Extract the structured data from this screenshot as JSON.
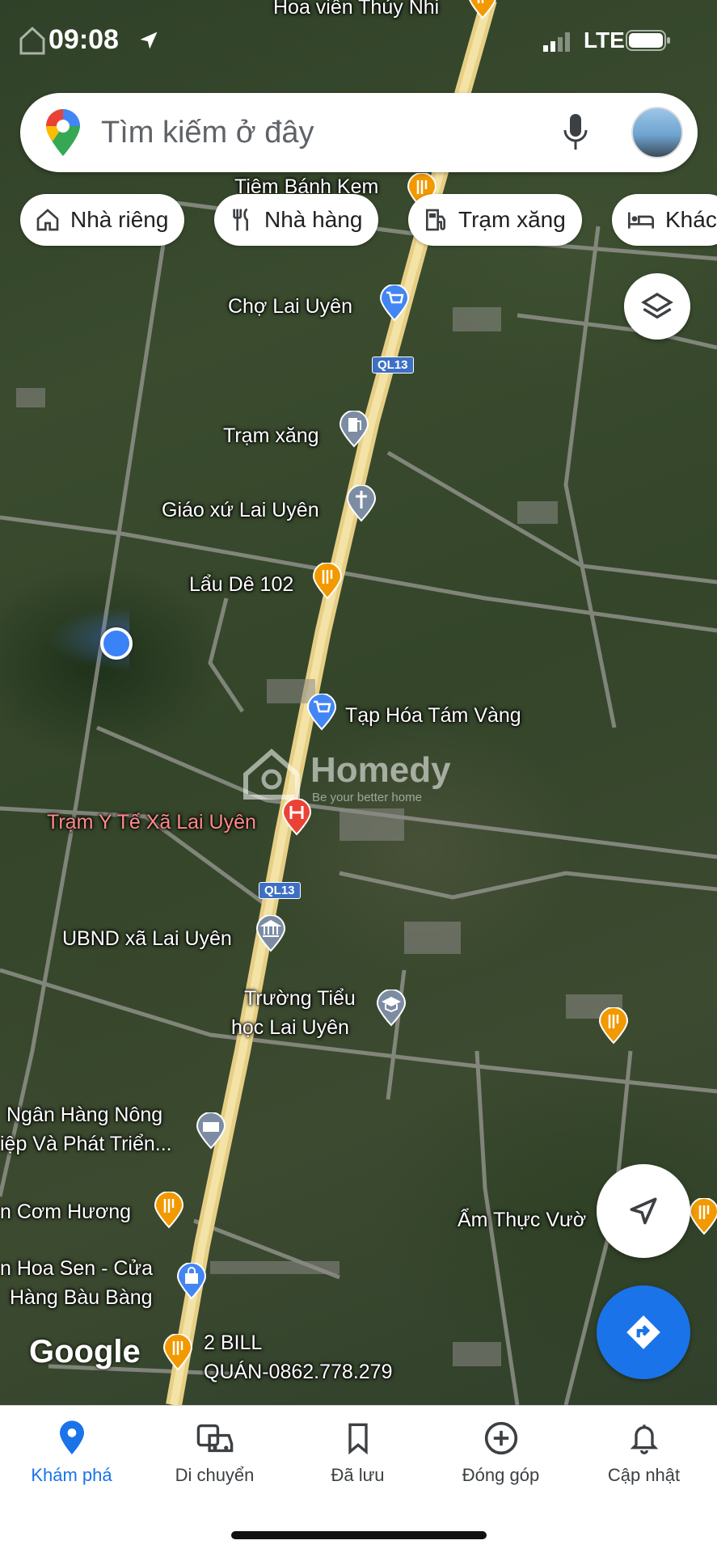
{
  "status_bar": {
    "time": "09:08",
    "network": "LTE"
  },
  "search": {
    "placeholder": "Tìm kiếm ở đây"
  },
  "chips": [
    {
      "label": "Nhà riêng",
      "icon": "home-icon"
    },
    {
      "label": "Nhà hàng",
      "icon": "restaurant-icon"
    },
    {
      "label": "Trạm xăng",
      "icon": "gas-station-icon"
    },
    {
      "label": "Khác",
      "icon": "hotel-icon"
    }
  ],
  "map": {
    "pois": [
      {
        "label": "Hoa viên Thủy Nhi",
        "type": "restaurant"
      },
      {
        "label": "Tiệm Bánh Kem",
        "type": "restaurant"
      },
      {
        "label": "Chợ Lai Uyên",
        "type": "shopping"
      },
      {
        "label": "Trạm xăng",
        "type": "gas"
      },
      {
        "label": "Giáo xứ Lai Uyên",
        "type": "church"
      },
      {
        "label": "Lẩu Dê 102",
        "type": "restaurant"
      },
      {
        "label": "Tạp Hóa Tám Vàng",
        "type": "shopping"
      },
      {
        "label": "Trạm Y Tế Xã Lai Uyên",
        "type": "hospital"
      },
      {
        "label": "UBND xã Lai Uyên",
        "type": "government"
      },
      {
        "label": "Trường Tiểu",
        "type": "school"
      },
      {
        "label": "học Lai Uyên",
        "type": "school"
      },
      {
        "label": "Ngân Hàng Nông",
        "type": "bank"
      },
      {
        "label": "iệp Và Phát Triển...",
        "type": "bank"
      },
      {
        "label": "n Cơm Hương",
        "type": "restaurant"
      },
      {
        "label": "n Hoa Sen - Cửa",
        "type": "shopping"
      },
      {
        "label": "Hàng Bàu Bàng",
        "type": "shopping"
      },
      {
        "label": "2 BILL",
        "type": "restaurant"
      },
      {
        "label": "QUÁN-0862.778.279",
        "type": "restaurant"
      },
      {
        "label": "Ẩm Thực Vườ",
        "type": "restaurant"
      }
    ],
    "road_shields": [
      "QL13",
      "QL13"
    ],
    "watermark": "Homedy",
    "watermark_sub": "Be your better home",
    "attribution": "Google"
  },
  "bottom_nav": [
    {
      "label": "Khám phá",
      "icon": "explore-pin-icon",
      "active": true
    },
    {
      "label": "Di chuyển",
      "icon": "commute-icon",
      "active": false
    },
    {
      "label": "Đã lưu",
      "icon": "bookmark-icon",
      "active": false
    },
    {
      "label": "Đóng góp",
      "icon": "add-circle-icon",
      "active": false
    },
    {
      "label": "Cập nhật",
      "icon": "bell-icon",
      "active": false
    }
  ],
  "colors": {
    "accent": "#1a73e8",
    "pin_orange": "#f29900",
    "pin_blue": "#4285f4",
    "pin_gray": "#7c8ca3",
    "pin_red": "#ea4335"
  }
}
